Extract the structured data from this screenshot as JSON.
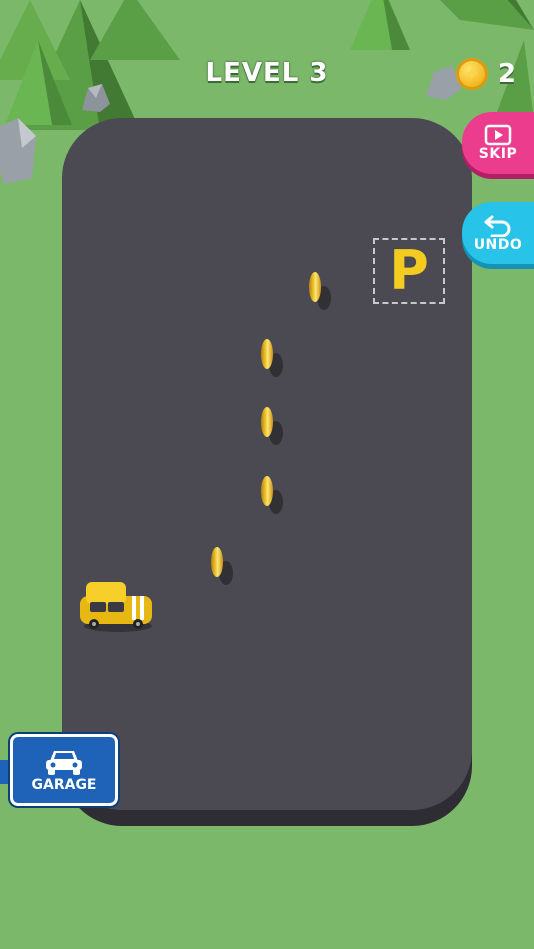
{
  "hud": {
    "level_label": "LEVEL 3",
    "coin_count": "2"
  },
  "buttons": {
    "skip_label": "SKIP",
    "undo_label": "UNDO",
    "garage_label": "GARAGE"
  },
  "parking": {
    "letter": "P"
  },
  "colors": {
    "grass": "#7bb86a",
    "asphalt": "#4b4a52",
    "skip": "#ec3c8e",
    "undo": "#27c3e8",
    "garage": "#1e63b8",
    "coin": "#f4cc21",
    "car": "#f2c51d"
  },
  "icons": {
    "coin": "coin-icon",
    "skip": "video-icon",
    "undo": "undo-arrow-icon",
    "garage": "car-icon"
  },
  "track_coins": 5
}
